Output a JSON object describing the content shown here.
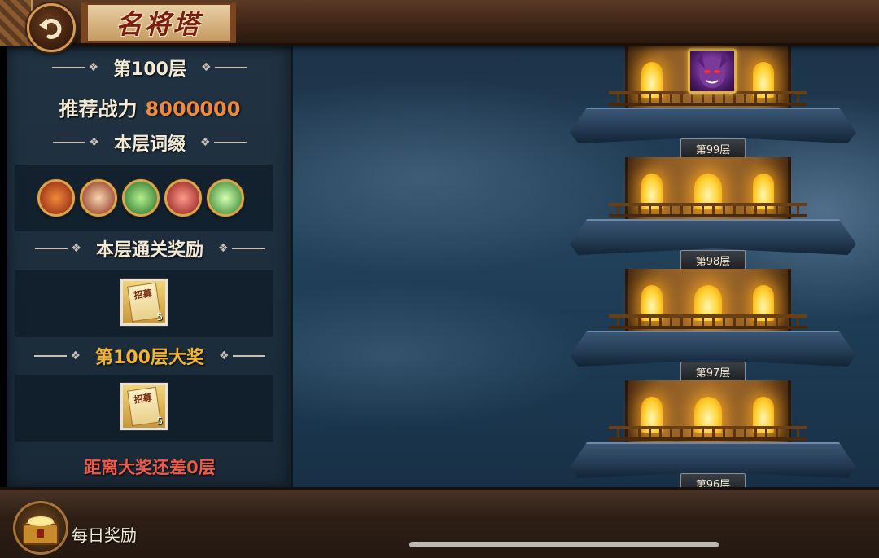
{
  "header": {
    "title": "名将塔"
  },
  "panel": {
    "floor_label": "第100层",
    "power_label": "推荐战力",
    "power_value": "8000000",
    "affix_label": "本层词缀",
    "affixes": [
      {
        "icon": "fire-swirl-icon",
        "color": "#d2442a"
      },
      {
        "icon": "red-slash-icon",
        "color": "#c9352a"
      },
      {
        "icon": "green-arrow-icon",
        "color": "#3aa84a"
      },
      {
        "icon": "red-claw-icon",
        "color": "#d8443a"
      },
      {
        "icon": "green-splash-icon",
        "color": "#5cbf4a"
      }
    ],
    "clear_reward_label": "本层通关奖励",
    "clear_reward": {
      "item_text": "招募",
      "quantity": "5"
    },
    "grand_prize_label": "第100层大奖",
    "grand_prize": {
      "item_text": "招募",
      "quantity": "5"
    },
    "distance_text": "距离大奖还差0层"
  },
  "tower": {
    "floors": [
      {
        "label": "第99层"
      },
      {
        "label": "第98层"
      },
      {
        "label": "第97层"
      },
      {
        "label": "第96层"
      }
    ]
  },
  "footer": {
    "daily_reward_label": "每日奖励"
  },
  "colors": {
    "accent_gold": "#f1b531",
    "power_orange": "#ef8a3a",
    "warning_red": "#ef5a4a"
  }
}
